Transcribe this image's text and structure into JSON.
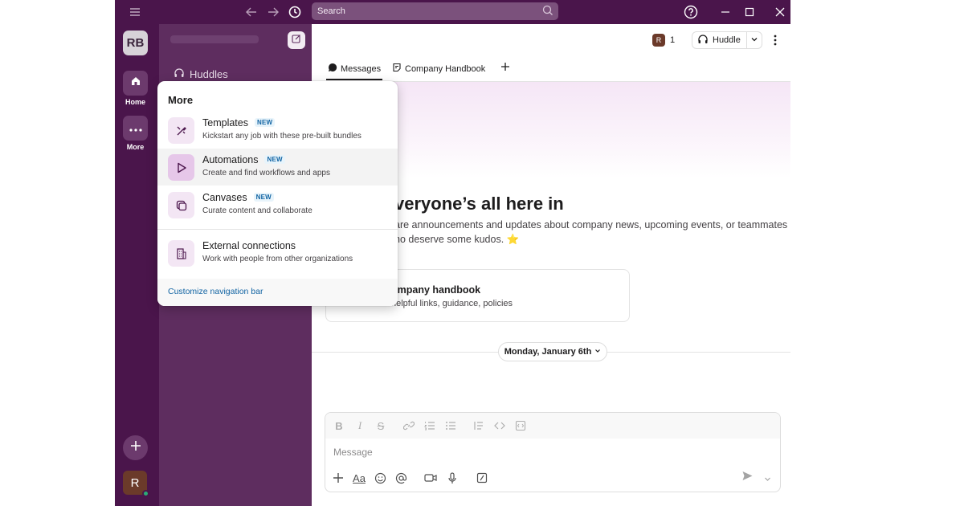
{
  "search": {
    "placeholder": "Search"
  },
  "rail": {
    "workspace_initials": "RB",
    "home_label": "Home",
    "more_label": "More",
    "user_initial": "R"
  },
  "sidebar": {
    "huddles_label": "Huddles"
  },
  "header": {
    "member_initial": "R",
    "member_count": "1",
    "huddle_label": "Huddle"
  },
  "tabs": [
    {
      "label": "Messages"
    },
    {
      "label": "Company Handbook"
    }
  ],
  "hero": {
    "title": "veryone’s all here in",
    "desc_line1": "are announcements and updates about company news, upcoming events, or teammates",
    "desc_line2": "ho deserve some kudos.",
    "star": "⭐"
  },
  "handbook_card": {
    "title": "ompany handbook",
    "subtitle": "helpful links, guidance, policies"
  },
  "date_divider": {
    "label": "Monday, January 6th"
  },
  "composer": {
    "placeholder": "Message"
  },
  "more_menu": {
    "title": "More",
    "new_badge": "NEW",
    "items": [
      {
        "name": "Templates",
        "description": "Kickstart any job with these pre-built bundles",
        "is_new": true,
        "icon": "templates-icon"
      },
      {
        "name": "Automations",
        "description": "Create and find workflows and apps",
        "is_new": true,
        "icon": "automations-icon"
      },
      {
        "name": "Canvases",
        "description": "Curate content and collaborate",
        "is_new": true,
        "icon": "canvases-icon"
      },
      {
        "name": "External connections",
        "description": "Work with people from other organizations",
        "is_new": false,
        "icon": "building-icon"
      }
    ],
    "footer_link": "Customize navigation bar"
  },
  "colors": {
    "aubergine": "#4a154b",
    "sidebar": "#5e2d5f",
    "link_blue": "#1264a3",
    "presence_green": "#2bac76"
  }
}
